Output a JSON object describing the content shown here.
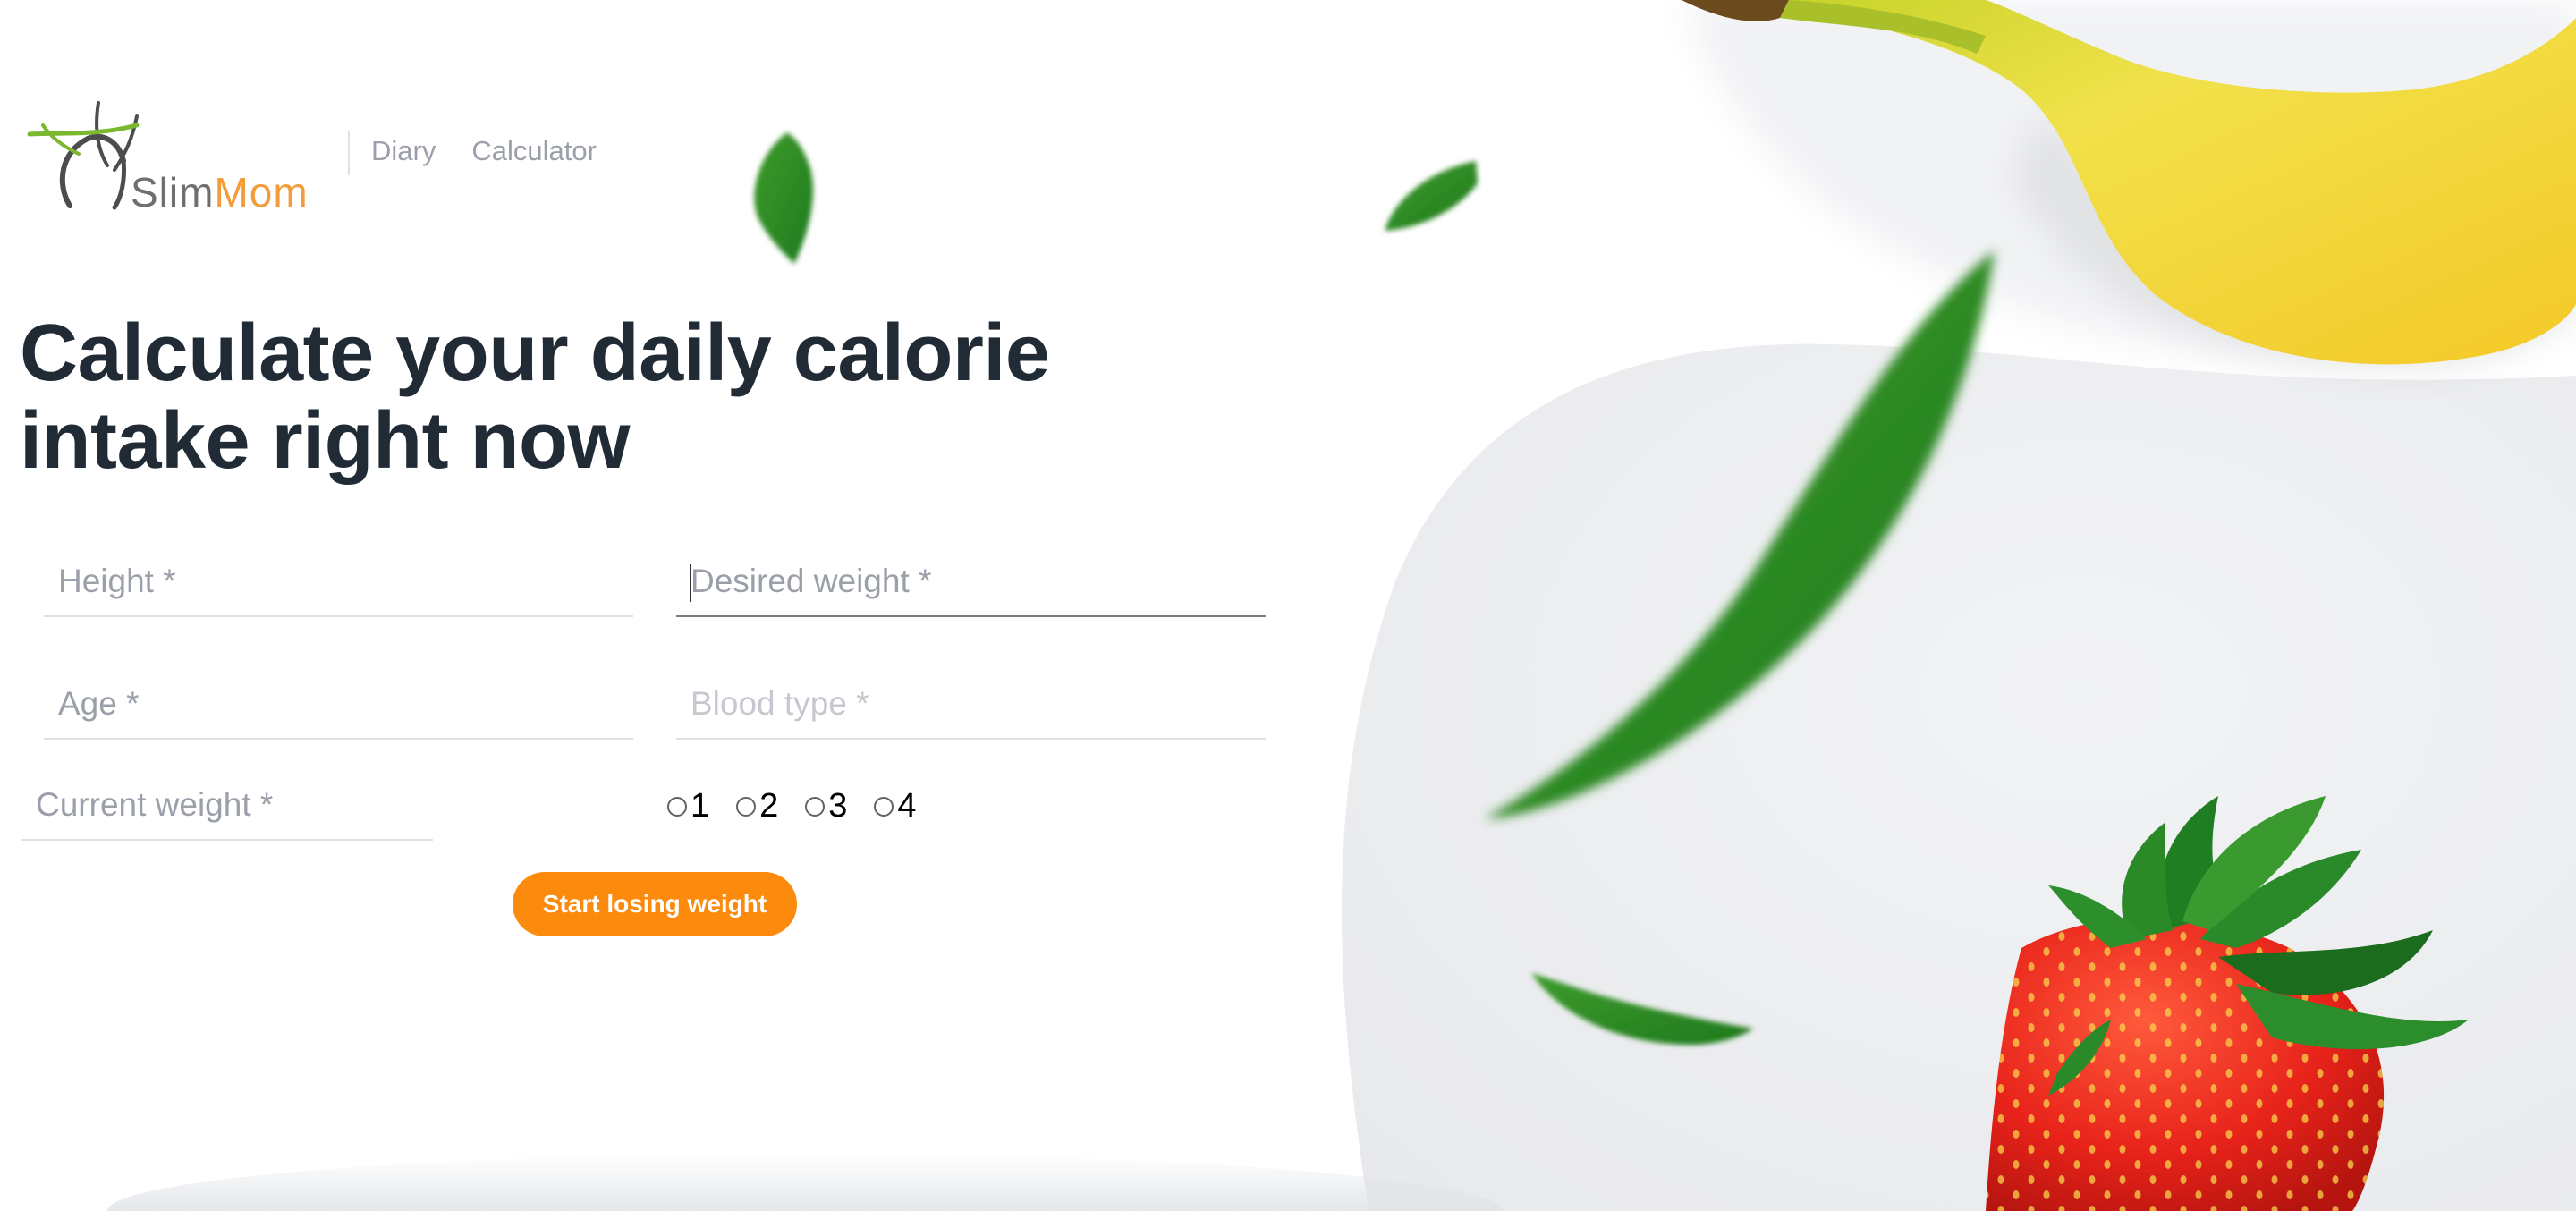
{
  "logo": {
    "text_slim": "Slim",
    "text_mom": "Mom"
  },
  "nav": {
    "items": [
      {
        "label": "Diary"
      },
      {
        "label": "Calculator"
      }
    ]
  },
  "main": {
    "title": "Calculate your daily calorie intake right now",
    "form": {
      "height_placeholder": "Height *",
      "desired_weight_placeholder": "Desired weight *",
      "age_placeholder": "Age *",
      "blood_type_placeholder": "Blood type *",
      "current_weight_placeholder": "Current weight *",
      "blood_type_options": [
        "1",
        "2",
        "3",
        "4"
      ],
      "submit_label": "Start losing weight"
    }
  },
  "colors": {
    "accent": "#fc8a0c",
    "title": "#212b36",
    "muted": "#9b9faa",
    "logo_mom": "#f39c3c"
  }
}
